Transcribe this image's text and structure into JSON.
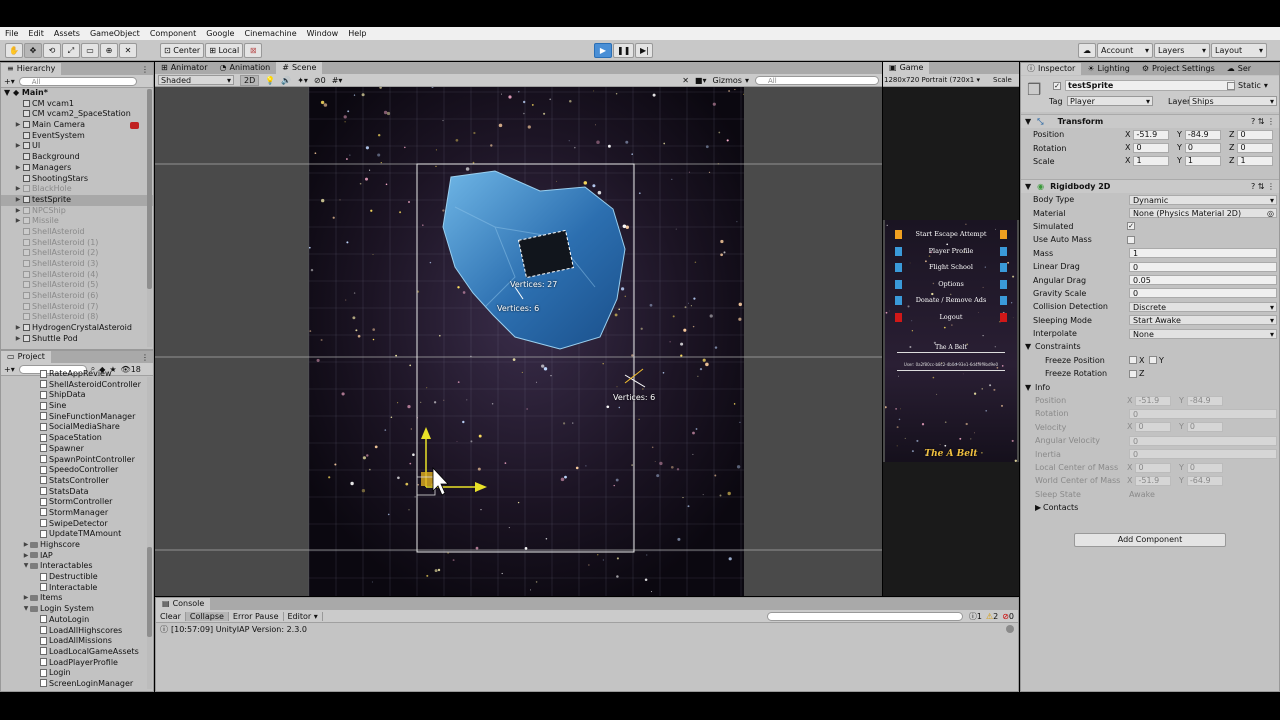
{
  "menu": [
    "File",
    "Edit",
    "Assets",
    "GameObject",
    "Component",
    "Google",
    "Cinemachine",
    "Window",
    "Help"
  ],
  "toolbar": {
    "pivot": "Center",
    "space": "Local",
    "account": "Account",
    "layers": "Layers",
    "layout": "Layout"
  },
  "hierarchy": {
    "tab": "Hierarchy",
    "search_placeholder": "All",
    "scene": "Main*",
    "items": [
      {
        "label": "CM vcam1",
        "indent": 1,
        "state": "normal",
        "arrow": ""
      },
      {
        "label": "CM vcam2_SpaceStation",
        "indent": 1,
        "state": "normal",
        "arrow": ""
      },
      {
        "label": "Main Camera",
        "indent": 1,
        "state": "normal",
        "arrow": "▶"
      },
      {
        "label": "EventSystem",
        "indent": 1,
        "state": "normal",
        "arrow": ""
      },
      {
        "label": "UI",
        "indent": 1,
        "state": "normal",
        "arrow": "▶"
      },
      {
        "label": "Background",
        "indent": 1,
        "state": "normal",
        "arrow": ""
      },
      {
        "label": "Managers",
        "indent": 1,
        "state": "normal",
        "arrow": "▶"
      },
      {
        "label": "ShootingStars",
        "indent": 1,
        "state": "normal",
        "arrow": ""
      },
      {
        "label": "BlackHole",
        "indent": 1,
        "state": "disabled",
        "arrow": "▶"
      },
      {
        "label": "testSprite",
        "indent": 1,
        "state": "selected",
        "arrow": "▶"
      },
      {
        "label": "NPCShip",
        "indent": 1,
        "state": "disabled",
        "arrow": "▶"
      },
      {
        "label": "Missile",
        "indent": 1,
        "state": "disabled",
        "arrow": "▶"
      },
      {
        "label": "ShellAsteroid",
        "indent": 1,
        "state": "disabled",
        "arrow": ""
      },
      {
        "label": "ShellAsteroid (1)",
        "indent": 1,
        "state": "disabled",
        "arrow": ""
      },
      {
        "label": "ShellAsteroid (2)",
        "indent": 1,
        "state": "disabled",
        "arrow": ""
      },
      {
        "label": "ShellAsteroid (3)",
        "indent": 1,
        "state": "disabled",
        "arrow": ""
      },
      {
        "label": "ShellAsteroid (4)",
        "indent": 1,
        "state": "disabled",
        "arrow": ""
      },
      {
        "label": "ShellAsteroid (5)",
        "indent": 1,
        "state": "disabled",
        "arrow": ""
      },
      {
        "label": "ShellAsteroid (6)",
        "indent": 1,
        "state": "disabled",
        "arrow": ""
      },
      {
        "label": "ShellAsteroid (7)",
        "indent": 1,
        "state": "disabled",
        "arrow": ""
      },
      {
        "label": "ShellAsteroid (8)",
        "indent": 1,
        "state": "disabled",
        "arrow": ""
      },
      {
        "label": "HydrogenCrystalAsteroid",
        "indent": 1,
        "state": "normal",
        "arrow": "▶"
      },
      {
        "label": "Shuttle Pod",
        "indent": 1,
        "state": "normal",
        "arrow": "▶"
      }
    ]
  },
  "project": {
    "tab": "Project",
    "count": "18",
    "items": [
      {
        "label": "RateAppReview",
        "type": "script",
        "indent": 3
      },
      {
        "label": "ShellAsteroidController",
        "type": "script",
        "indent": 3
      },
      {
        "label": "ShipData",
        "type": "script",
        "indent": 3
      },
      {
        "label": "Sine",
        "type": "script",
        "indent": 3
      },
      {
        "label": "SineFunctionManager",
        "type": "script",
        "indent": 3
      },
      {
        "label": "SocialMediaShare",
        "type": "script",
        "indent": 3
      },
      {
        "label": "SpaceStation",
        "type": "script",
        "indent": 3
      },
      {
        "label": "Spawner",
        "type": "script",
        "indent": 3
      },
      {
        "label": "SpawnPointController",
        "type": "script",
        "indent": 3
      },
      {
        "label": "SpeedoController",
        "type": "script",
        "indent": 3
      },
      {
        "label": "StatsController",
        "type": "script",
        "indent": 3
      },
      {
        "label": "StatsData",
        "type": "script",
        "indent": 3
      },
      {
        "label": "StormController",
        "type": "script",
        "indent": 3
      },
      {
        "label": "StormManager",
        "type": "script",
        "indent": 3
      },
      {
        "label": "SwipeDetector",
        "type": "script",
        "indent": 3
      },
      {
        "label": "UpdateTMAmount",
        "type": "script",
        "indent": 3
      },
      {
        "label": "Highscore",
        "type": "folder",
        "indent": 2,
        "arrow": "▶"
      },
      {
        "label": "IAP",
        "type": "folder",
        "indent": 2,
        "arrow": "▶"
      },
      {
        "label": "Interactables",
        "type": "folder",
        "indent": 2,
        "arrow": "▼"
      },
      {
        "label": "Destructible",
        "type": "script",
        "indent": 3
      },
      {
        "label": "Interactable",
        "type": "script",
        "indent": 3
      },
      {
        "label": "Items",
        "type": "folder",
        "indent": 2,
        "arrow": "▶"
      },
      {
        "label": "Login System",
        "type": "folder",
        "indent": 2,
        "arrow": "▼"
      },
      {
        "label": "AutoLogin",
        "type": "script",
        "indent": 3
      },
      {
        "label": "LoadAllHighscores",
        "type": "script",
        "indent": 3
      },
      {
        "label": "LoadAllMissions",
        "type": "script",
        "indent": 3
      },
      {
        "label": "LoadLocalGameAssets",
        "type": "script",
        "indent": 3
      },
      {
        "label": "LoadPlayerProfile",
        "type": "script",
        "indent": 3
      },
      {
        "label": "Login",
        "type": "script",
        "indent": 3
      },
      {
        "label": "ScreenLoginManager",
        "type": "script",
        "indent": 3
      }
    ]
  },
  "scene": {
    "tabs": [
      "Animator",
      "Animation",
      "Scene"
    ],
    "shading": "Shaded",
    "mode2d": "2D",
    "gizmos": "Gizmos",
    "search_placeholder": "All",
    "hidden_count": "0",
    "labels": {
      "v27": "Vertices: 27",
      "v6a": "Vertices: 6",
      "v6b": "Vertices: 6"
    }
  },
  "game": {
    "tab": "Game",
    "resolution": "1280x720 Portrait (720x1",
    "scale": "Scale",
    "menu": [
      {
        "label": "Start Escape Attempt",
        "color": "#f0a020"
      },
      {
        "label": "Player Profile",
        "color": "#3a9ad9"
      },
      {
        "label": "Flight School",
        "color": "#3a9ad9"
      },
      {
        "label": "Options",
        "color": "#3a9ad9"
      },
      {
        "label": "Donate / Remove Ads",
        "color": "#3a9ad9"
      },
      {
        "label": "Logout",
        "color": "#d01818"
      }
    ],
    "belt_title": "The A Belt",
    "user_line": "User: 0a2f80cc-b8c2-4b0d-93e1-6d4f9f9bd9e0",
    "footer_logo": "The A Belt"
  },
  "inspector": {
    "tabs": [
      "Inspector",
      "Lighting",
      "Project Settings",
      "Ser"
    ],
    "object_name": "testSprite",
    "static_label": "Static",
    "tag_label": "Tag",
    "tag": "Player",
    "layer_label": "Layer",
    "layer": "Ships",
    "transform": {
      "title": "Transform",
      "position": {
        "label": "Position",
        "x": "-51.9",
        "y": "-84.9",
        "z": "0"
      },
      "rotation": {
        "label": "Rotation",
        "x": "0",
        "y": "0",
        "z": "0"
      },
      "scale": {
        "label": "Scale",
        "x": "1",
        "y": "1",
        "z": "1"
      }
    },
    "rigidbody": {
      "title": "Rigidbody 2D",
      "rows": [
        {
          "label": "Body Type",
          "value": "Dynamic",
          "kind": "dropdown"
        },
        {
          "label": "Material",
          "value": "None (Physics Material 2D)",
          "kind": "object"
        },
        {
          "label": "Simulated",
          "value": "✓",
          "kind": "check"
        },
        {
          "label": "Use Auto Mass",
          "value": "",
          "kind": "check"
        },
        {
          "label": "Mass",
          "value": "1",
          "kind": "field"
        },
        {
          "label": "Linear Drag",
          "value": "0",
          "kind": "field"
        },
        {
          "label": "Angular Drag",
          "value": "0.05",
          "kind": "field"
        },
        {
          "label": "Gravity Scale",
          "value": "0",
          "kind": "field"
        },
        {
          "label": "Collision Detection",
          "value": "Discrete",
          "kind": "dropdown"
        },
        {
          "label": "Sleeping Mode",
          "value": "Start Awake",
          "kind": "dropdown"
        },
        {
          "label": "Interpolate",
          "value": "None",
          "kind": "dropdown"
        }
      ],
      "constraints": "Constraints",
      "freeze_position": "Freeze Position",
      "freeze_rotation": "Freeze Rotation",
      "axis_x": "X",
      "axis_y": "Y",
      "axis_z": "Z",
      "info": "Info",
      "info_rows": [
        {
          "label": "Position",
          "x": "-51.9",
          "y": "-84.9"
        },
        {
          "label": "Rotation",
          "value": "0"
        },
        {
          "label": "Velocity",
          "x": "0",
          "y": "0"
        },
        {
          "label": "Angular Velocity",
          "value": "0"
        },
        {
          "label": "Inertia",
          "value": "0"
        },
        {
          "label": "Local Center of Mass",
          "x": "0",
          "y": "0"
        },
        {
          "label": "World Center of Mass",
          "x": "-51.9",
          "y": "-64.9"
        },
        {
          "label": "Sleep State",
          "value": "Awake"
        }
      ],
      "contacts": "Contacts"
    },
    "add_component": "Add Component"
  },
  "console": {
    "tab": "Console",
    "buttons": [
      "Clear",
      "Collapse",
      "Error Pause",
      "Editor"
    ],
    "count_info": "1",
    "count_warn": "2",
    "count_err": "0",
    "log": "[10:57:09] UnityIAP Version: 2.3.0"
  }
}
